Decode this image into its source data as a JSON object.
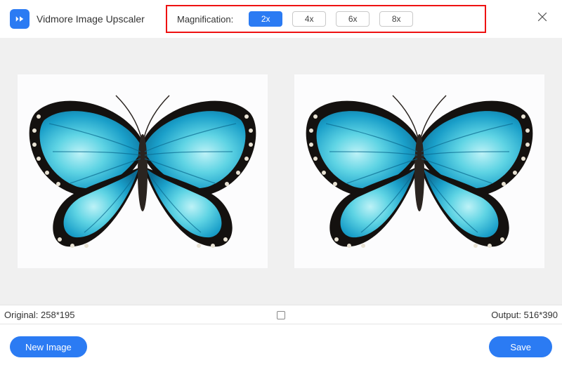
{
  "app": {
    "title": "Vidmore Image Upscaler"
  },
  "magnification": {
    "label": "Magnification:",
    "options": [
      "2x",
      "4x",
      "6x",
      "8x"
    ],
    "selected": "2x"
  },
  "status": {
    "original_label": "Original",
    "original_dims": "258*195",
    "output_label": "Output",
    "output_dims": "516*390"
  },
  "buttons": {
    "new_image": "New Image",
    "save": "Save"
  },
  "colors": {
    "accent": "#2b7bf3",
    "highlight_border": "#e11"
  }
}
